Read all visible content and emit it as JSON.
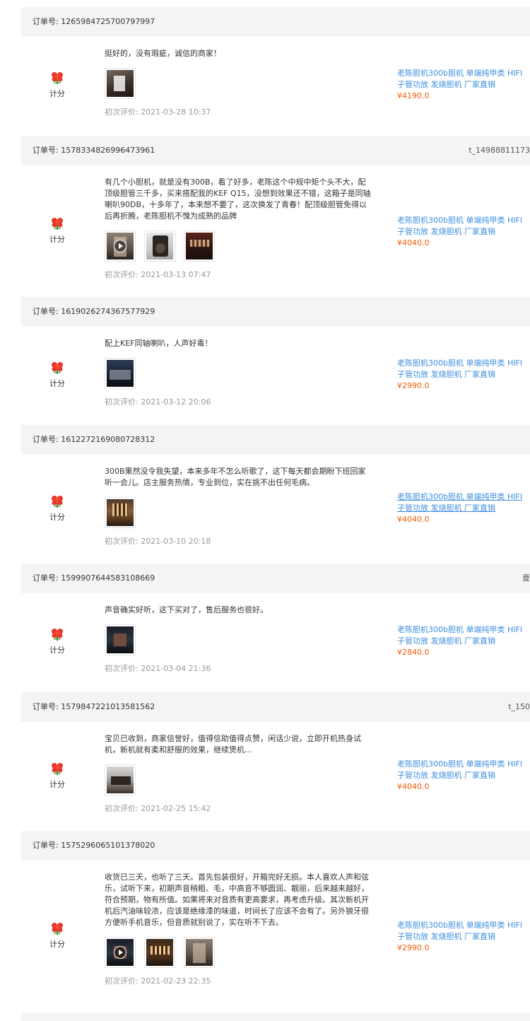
{
  "labels": {
    "order_prefix": "订单号:",
    "score": "计分",
    "date_prefix": "初次评价:"
  },
  "reviews": [
    {
      "order_no": "1265984725700797997",
      "buyer": "",
      "comment": "挺好的，没有瑕疵，诚信的商家！",
      "thumbs": [
        {
          "icon": "photo-thumbnail",
          "video": false
        }
      ],
      "date": "2021-03-28 10:37",
      "product": {
        "title_line1": "老陈胆机300b胆机 单端纯甲类 HIFI",
        "title_line2": "子管功放 发烧胆机 厂家直销",
        "price": "¥4190.0"
      }
    },
    {
      "order_no": "1578334826996473961",
      "buyer": "t_14988811173",
      "comment": "有几个小胆机，就是没有300B，看了好多，老陈这个中规中矩个头不大，配顶级胆管三千多，买来搭配我的KEF Q15，没想到效果还不错，这箱子是同轴喇叭90DB，十多年了，本来想不要了，这次换发了青春！配顶级胆管免得以后再折腾，老陈胆机不愧为成熟的品牌",
      "thumbs": [
        {
          "icon": "video-thumbnail",
          "video": true
        },
        {
          "icon": "photo-thumbnail",
          "video": false
        },
        {
          "icon": "photo-thumbnail",
          "video": false
        }
      ],
      "date": "2021-03-13 07:47",
      "product": {
        "title_line1": "老陈胆机300b胆机 单端纯甲类 HIFI",
        "title_line2": "子管功放 发烧胆机 厂家直销",
        "price": "¥4040.0"
      }
    },
    {
      "order_no": "1619026274367577929",
      "buyer": "",
      "comment": "配上KEF同轴喇叭，人声好毒！",
      "thumbs": [
        {
          "icon": "photo-thumbnail",
          "video": false
        }
      ],
      "date": "2021-03-12 20:06",
      "product": {
        "title_line1": "老陈胆机300b胆机 单端纯甲类 HIFI",
        "title_line2": "子管功放 发烧胆机 厂家直销",
        "price": "¥2990.0"
      }
    },
    {
      "order_no": "1612272169080728312",
      "buyer": "",
      "comment": "300B果然没令我失望，本来多年不怎么听歌了，这下每天都会期盼下班回家听一会儿。店主服务热情，专业到位，实在挑不出任何毛病。",
      "thumbs": [
        {
          "icon": "photo-thumbnail",
          "video": false
        }
      ],
      "date": "2021-03-10 20:18",
      "product": {
        "title_line1": "老陈胆机300b胆机 单端纯甲类 HIFI",
        "title_line2": "子管功放 发烧胆机 厂家直销",
        "price": "¥4040.0"
      }
    },
    {
      "order_no": "1599907644583108669",
      "buyer": "壹",
      "comment": "声音确实好听，这下买对了，售后服务也很好。",
      "thumbs": [
        {
          "icon": "photo-thumbnail",
          "video": false
        }
      ],
      "date": "2021-03-04 21:36",
      "product": {
        "title_line1": "老陈胆机300b胆机 单端纯甲类 HIFI",
        "title_line2": "子管功放 发烧胆机 厂家直销",
        "price": "¥2840.0"
      }
    },
    {
      "order_no": "1579847221013581562",
      "buyer": "t_150",
      "comment": "宝贝已收到，商家信誉好，值得信助值得点赞，闲话少说，立即开机热身试机，新机就有柔和舒服的效果，继续煲机...",
      "thumbs": [
        {
          "icon": "photo-thumbnail",
          "video": false
        }
      ],
      "date": "2021-02-25 15:42",
      "product": {
        "title_line1": "老陈胆机300b胆机 单端纯甲类 HIFI",
        "title_line2": "子管功放 发烧胆机 厂家直销",
        "price": "¥4040.0"
      }
    },
    {
      "order_no": "1575296065101378020",
      "buyer": "",
      "comment": "收货已三天，也听了三天。首先包装很好，开箱完好无损。本人喜欢人声和弦乐，试听下来，初期声音稍粗、毛，中高音不够圆润、靓丽，后来越来越好，符合预期，物有所值。如果将来对音质有更高要求，再考虑升级。其次新机开机后汽油味较浓，应该是绝缘漆的味道，时间长了应该不会有了。另外狼牙很方便听手机音乐，但音质就别说了，实在听不下去。",
      "thumbs": [
        {
          "icon": "video-thumbnail",
          "video": true
        },
        {
          "icon": "photo-thumbnail",
          "video": false
        },
        {
          "icon": "photo-thumbnail",
          "video": false
        }
      ],
      "date": "2021-02-23 22:35",
      "product": {
        "title_line1": "老陈胆机300b胆机 单端纯甲类 HIFI",
        "title_line2": "子管功放 发烧胆机 厂家直销",
        "price": "¥2990.0"
      }
    }
  ]
}
